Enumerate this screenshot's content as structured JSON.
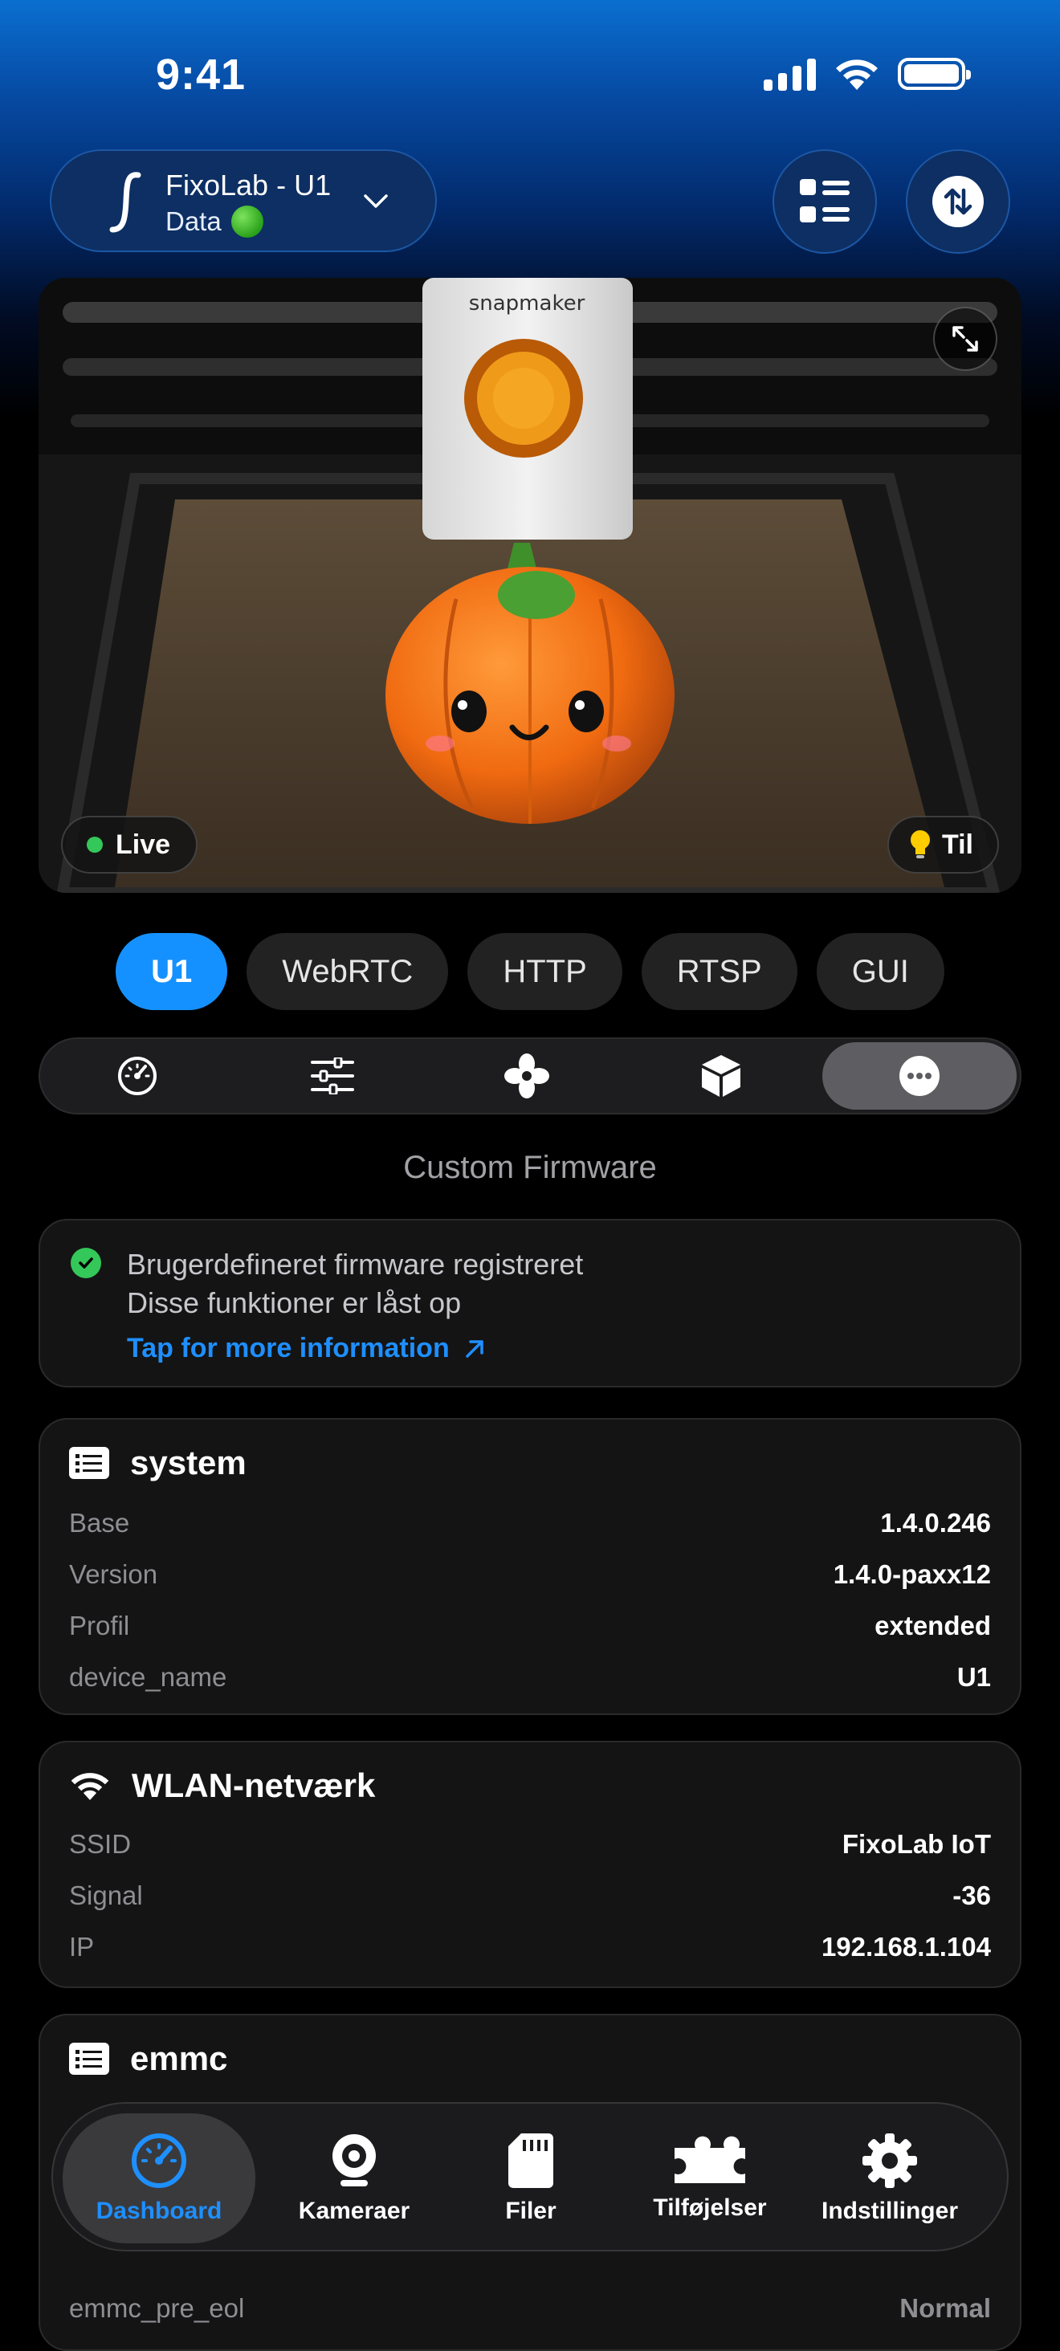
{
  "status_bar": {
    "time": "9:41"
  },
  "header": {
    "printer_name": "FixoLab - U1",
    "connection_label": "Data"
  },
  "camera": {
    "live_label": "Live",
    "light_label": "Til"
  },
  "stream_tabs": [
    {
      "label": "U1",
      "active": true
    },
    {
      "label": "WebRTC"
    },
    {
      "label": "HTTP"
    },
    {
      "label": "RTSP"
    },
    {
      "label": "GUI"
    }
  ],
  "segments": [
    {
      "icon": "gauge-icon"
    },
    {
      "icon": "sliders-icon"
    },
    {
      "icon": "fan-icon"
    },
    {
      "icon": "box-icon"
    },
    {
      "icon": "more-icon",
      "active": true
    }
  ],
  "section_title": "Custom Firmware",
  "firmware": {
    "line1": "Brugerdefineret firmware registreret",
    "line2": "Disse funktioner er låst op",
    "link": "Tap for more information"
  },
  "system": {
    "title": "system",
    "rows": [
      {
        "key": "Base",
        "value": "1.4.0.246"
      },
      {
        "key": "Version",
        "value": "1.4.0-paxx12"
      },
      {
        "key": "Profil",
        "value": "extended"
      },
      {
        "key": "device_name",
        "value": "U1"
      }
    ]
  },
  "wlan": {
    "title": "WLAN-netværk",
    "rows": [
      {
        "key": "SSID",
        "value": "FixoLab IoT"
      },
      {
        "key": "Signal",
        "value": "-36"
      },
      {
        "key": "IP",
        "value": "192.168.1.104"
      }
    ]
  },
  "emmc": {
    "title": "emmc",
    "rows": [
      {
        "key": "emmc_pre_eol",
        "value": "Normal"
      }
    ]
  },
  "tabbar": [
    {
      "label": "Dashboard",
      "icon": "gauge-icon",
      "active": true
    },
    {
      "label": "Kameraer",
      "icon": "webcam-icon"
    },
    {
      "label": "Filer",
      "icon": "sd-card-icon"
    },
    {
      "label": "Tilføjelser",
      "icon": "puzzle-icon"
    },
    {
      "label": "Indstillinger",
      "icon": "gear-icon"
    }
  ],
  "colors": {
    "accent": "#1591ff",
    "success": "#34c759",
    "link": "#1e8fff"
  }
}
